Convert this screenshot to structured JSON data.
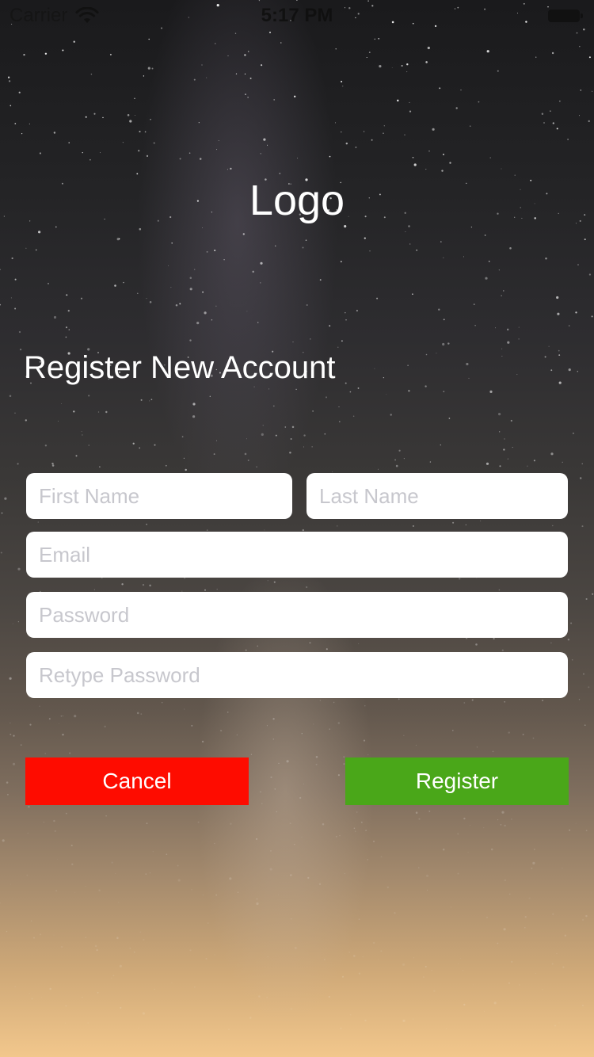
{
  "status_bar": {
    "carrier": "Carrier",
    "time": "5:17 PM"
  },
  "logo": "Logo",
  "heading": "Register New Account",
  "form": {
    "first_name_placeholder": "First Name",
    "last_name_placeholder": "Last Name",
    "email_placeholder": "Email",
    "password_placeholder": "Password",
    "retype_password_placeholder": "Retype Password"
  },
  "buttons": {
    "cancel": {
      "label": "Cancel",
      "color": "#fe0c00"
    },
    "register": {
      "label": "Register",
      "color": "#4aa719"
    }
  },
  "icons": {
    "wifi": "wifi-icon",
    "battery": "battery-icon"
  }
}
